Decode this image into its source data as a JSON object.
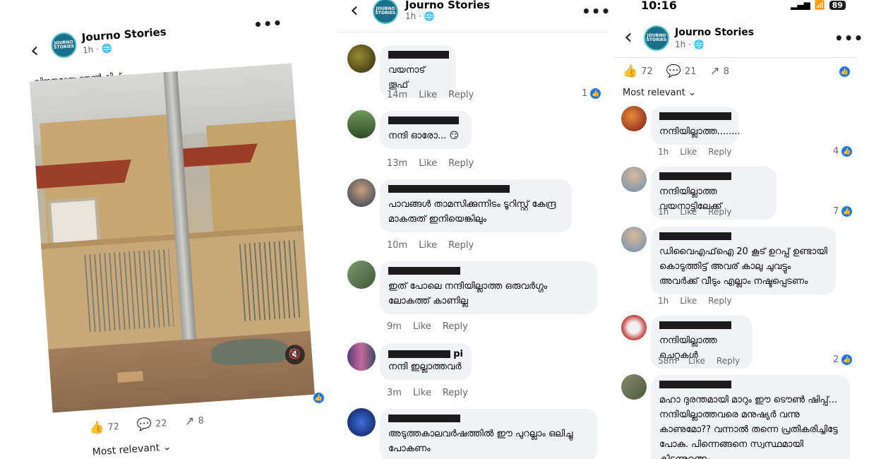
{
  "page": {
    "name": "Journo Stories",
    "avatar_text": [
      "JOURNO",
      "STORIES"
    ],
    "time": "1h ·",
    "globe": "🌐"
  },
  "panel1": {
    "caption": "വിജനമായ ടൗൺഷിപ്പ്,",
    "likes": "72",
    "comments": "22",
    "shares": "8",
    "most_relevant": "Most relevant"
  },
  "panel2": {
    "comments": [
      {
        "text": "വയനാട് തൂഫ്",
        "time": "14m",
        "like": "Like",
        "reply": "Reply",
        "reactions": "1"
      },
      {
        "text": "നന്ദി ഓരോ... 😏",
        "time": "13m",
        "like": "Like",
        "reply": "Reply",
        "reactions": ""
      },
      {
        "text": "പാവങ്ങൾ താമസിക്കുന്നിടം ടൂറിസ്റ്റ് കേന്ദ്ര മാകരുത് ഇനിയെങ്കിലും",
        "time": "10m",
        "like": "Like",
        "reply": "Reply",
        "reactions": ""
      },
      {
        "text": "ഇത് പോലെ നന്ദിയില്ലാത്ത ഒരുവർഗ്ഗം ലോകത്ത് കാണില്ല",
        "time": "9m",
        "like": "Like",
        "reply": "Reply",
        "reactions": ""
      },
      {
        "name_tail": "pi",
        "text": "നന്ദി ഇല്ലാത്തവർ",
        "time": "3m",
        "like": "Like",
        "reply": "Reply",
        "reactions": ""
      },
      {
        "text": "അടുത്തകാലവർഷത്തിൽ ഈ പുറല്ലാം ഒലിച്ചു പോകണം",
        "time": "",
        "like": "",
        "reply": "",
        "reactions": ""
      }
    ]
  },
  "panel3": {
    "status_time": "10:16",
    "battery": "89",
    "likes": "72",
    "comments": "21",
    "shares": "8",
    "most_relevant": "Most relevant",
    "comments_list": [
      {
        "text": "നന്ദിയില്ലാത്ത........",
        "time": "1h",
        "like": "Like",
        "reply": "Reply",
        "reactions": "4"
      },
      {
        "text": "നന്ദിയില്ലാത്ത വയനാട്ടിലേക്ക്",
        "time": "1h",
        "like": "Like",
        "reply": "Reply",
        "reactions": "7"
      },
      {
        "text": "ഡിവൈഎഫ്ഐ 20 കൂട് ഉറപ്പ് ഉണ്ടായി കൊടുത്തിട്ട് അവര് കാലു ചുവട്ടും അവർക്ക് വീടും എല്ലാം നഷ്ടപ്പെടണം",
        "time": "1h",
        "like": "Like",
        "reply": "Reply",
        "reactions": ""
      },
      {
        "text": "നന്ദിയില്ലാത്ത ചെറ്റകൾ",
        "time": "58m",
        "like": "Like",
        "reply": "Reply",
        "reactions": "2"
      },
      {
        "text": "മഹാ ദുരന്തമായി മാറും ഈ ടൌൺ ഷിപ്പ്... നന്ദിയില്ലാത്തവരെ മനുഷ്യർ വന്നു കാണുമോ?? വന്നാൽ തന്നെ പ്രതികരിച്ചിട്ടേ പോകു. പിന്നെങ്ങനെ സ്വസ്ഥമായി കിടന്നുറങ്ങും",
        "time": "",
        "like": "",
        "reply": "",
        "reactions": ""
      }
    ]
  },
  "icons": {
    "back": "chevron-left",
    "more": "more-dots",
    "like": "thumbs-up",
    "comment": "speech-bubble",
    "share": "share-arrow",
    "mute": "speaker-muted"
  },
  "colors": {
    "accent": "#1877f2",
    "bubble": "#f0f2f5",
    "muted_text": "#65676b"
  }
}
